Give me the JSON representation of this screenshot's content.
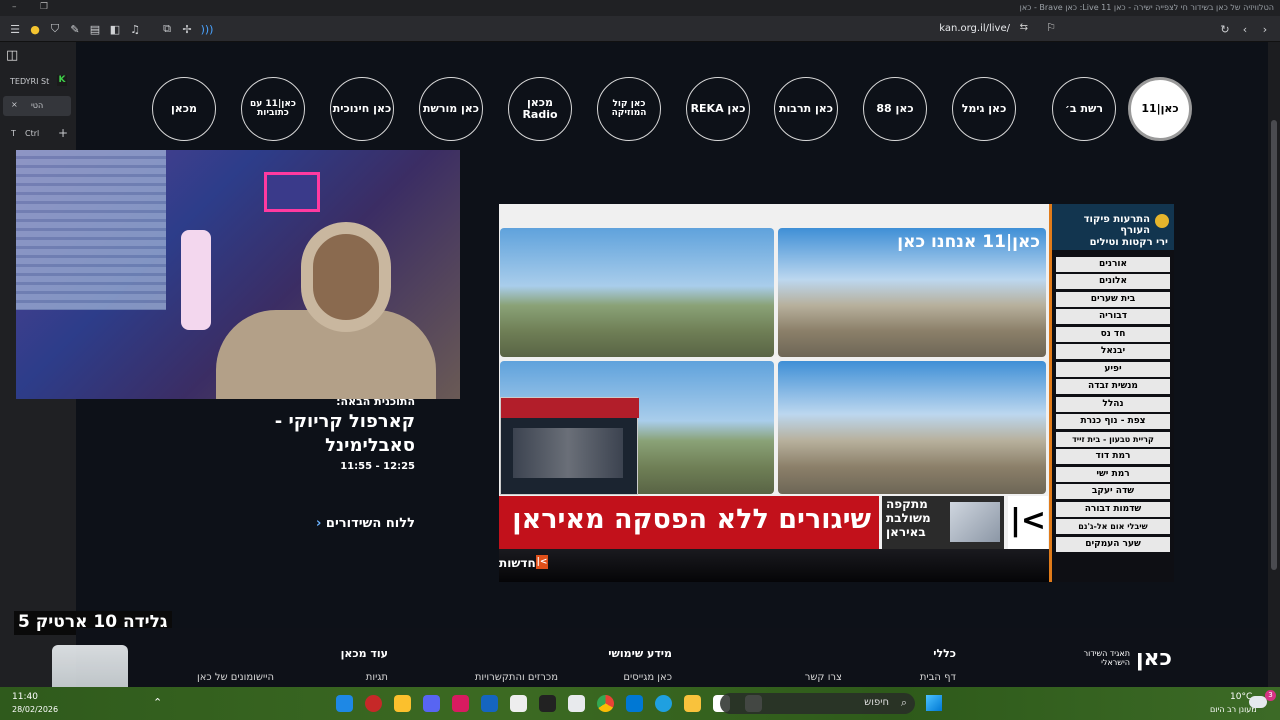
{
  "window": {
    "title": "הטלוויזיה של כאן בשידור חי לצפייה ישירה - כאן 11 Live: כאן Brave - כאן"
  },
  "browser": {
    "url": "kan.org.il/live/",
    "sidebar_tab_label": "TEDYRI St",
    "sidebar_tab2": "הטי",
    "sidebar_ctrl": "Ctrl",
    "sidebar_t": "T",
    "sidebar_plus": "+",
    "sidebar_close": "×"
  },
  "channels": [
    {
      "id": "kan11",
      "label": "כאן|11",
      "selected": true
    },
    {
      "id": "reshet-bet",
      "label": "רשת ב׳"
    },
    {
      "id": "gimmel",
      "label": "כאן גימל"
    },
    {
      "id": "88",
      "label": "כאן 88"
    },
    {
      "id": "tarbut",
      "label": "כאן תרבות"
    },
    {
      "id": "reka",
      "label": "REKA כאן"
    },
    {
      "id": "kol-hamusica",
      "label": "כאן קול המוזיקה"
    },
    {
      "id": "makan-radio",
      "label": "מכאן Radio"
    },
    {
      "id": "moreshet",
      "label": "כאן מורשת"
    },
    {
      "id": "chinuchit",
      "label": "כאן חינוכית"
    },
    {
      "id": "kan11-sign",
      "label": "כאן|11 עם כתוביות"
    },
    {
      "id": "makan",
      "label": "מכאן"
    }
  ],
  "player": {
    "watermark": "כאן|11 אנחנו כאן",
    "alert_title": "התרעות פיקוד העורף",
    "alert_subtitle": "ירי רקטות וטילים",
    "alert_cities": [
      "אורנים",
      "אלונים",
      "בית שערים",
      "דבוריה",
      "חד נס",
      "יבנאל",
      "יפיע",
      "מנשית זבדה",
      "נהלל",
      "צפת - נוף כנרת",
      "קריית טבעון - בית זייד",
      "רמת דוד",
      "רמת ישי",
      "שדה יעקב",
      "שדמות דבורה",
      "שיבלי אום אל-ג'נם",
      "שער העמקים"
    ],
    "ticker_text": "שיגורים ללא הפסקה מאיראן",
    "side_text": [
      "מתקפה",
      "משולבת",
      "באיראן"
    ],
    "news_tag": "חדשות"
  },
  "next_program": {
    "label": "התוכנית הבאה:",
    "title_line1": "קארפול קריוקי -",
    "title_line2": "סאבלימינל",
    "time": "11:55 - 12:25",
    "schedule_link": "ללוח השידורים"
  },
  "overlay": {
    "caption": "גלידה 10 ארטיק 5"
  },
  "footer": {
    "logo": "כאן",
    "logo_sub": "תאגיד השידור הישראלי",
    "columns": [
      {
        "heading": "כללי",
        "link": "דף הבית"
      },
      {
        "heading": "",
        "link": "צרו קשר"
      },
      {
        "heading": "מידע שימושי",
        "link": "כאן מגייסים"
      },
      {
        "heading": "",
        "link": "מכרזים והתקשרויות"
      },
      {
        "heading": "עוד מכאן",
        "link": "תגיות"
      },
      {
        "heading": "",
        "link": "היישומונים של כאן"
      }
    ]
  },
  "taskbar": {
    "time": "11:40",
    "date": "28/02/2026",
    "weather_temp": "10°C",
    "weather_desc": "מעונן רב היום",
    "search_placeholder": "חיפוש",
    "notif_count": "3"
  },
  "colors": {
    "accent_orange": "#e07b1a",
    "ticker_red": "#c2111b",
    "news_orange": "#e0501a"
  }
}
